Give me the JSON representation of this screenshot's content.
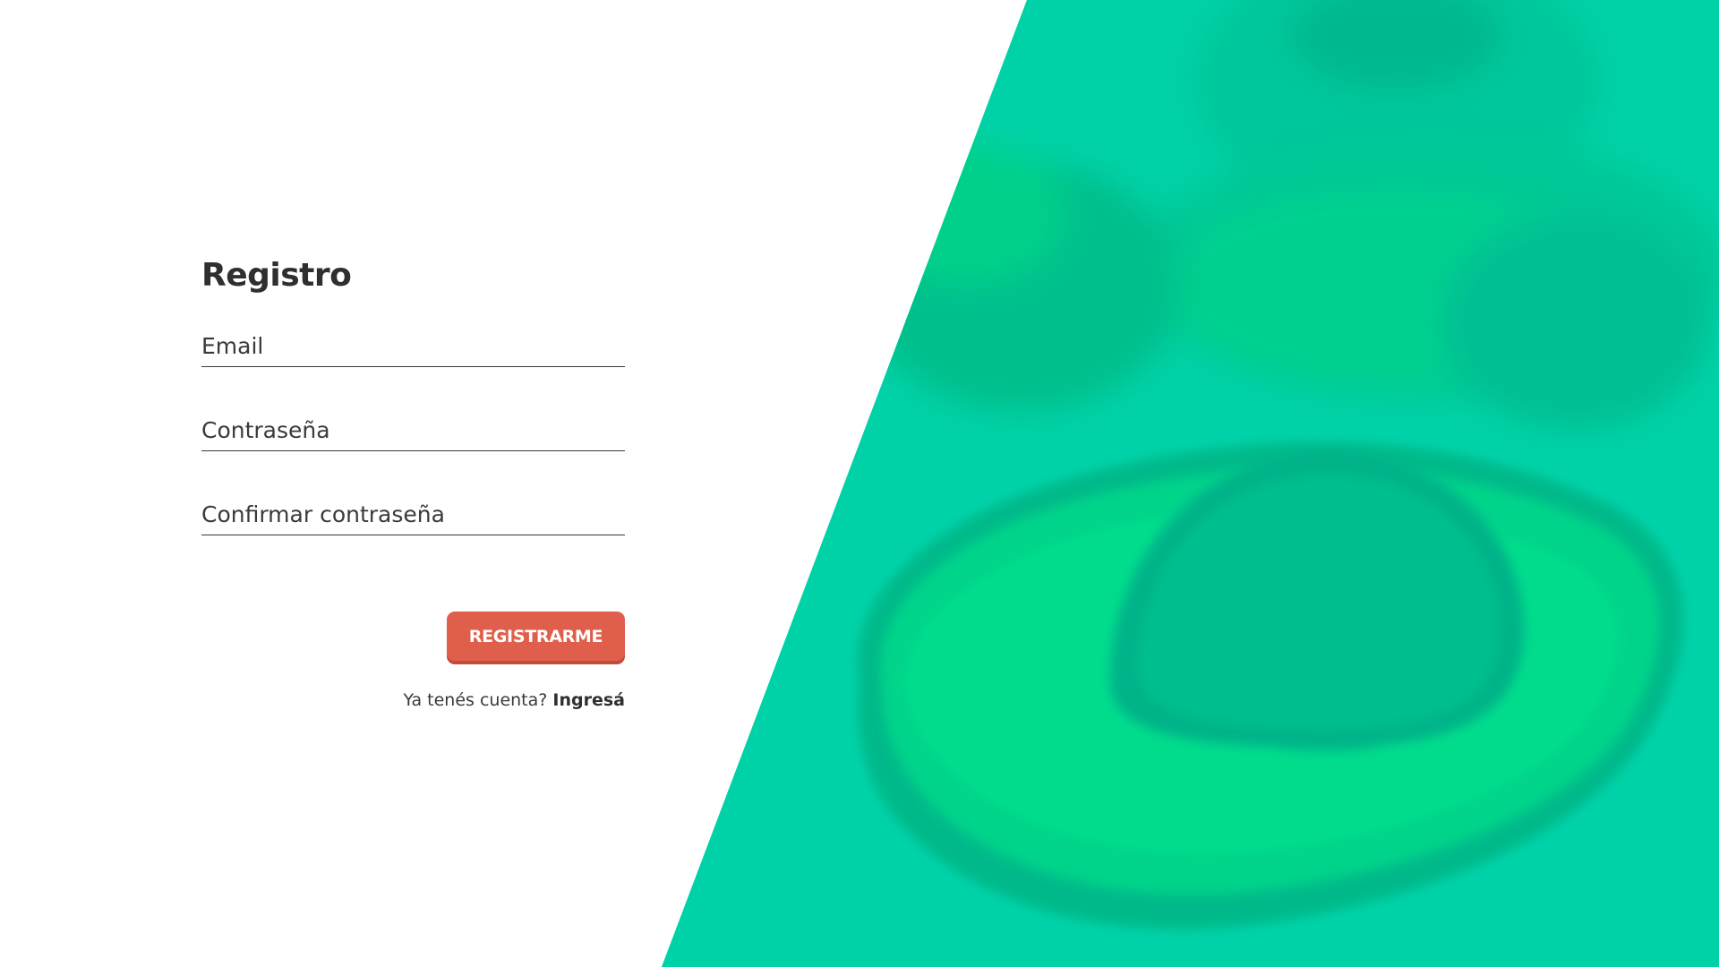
{
  "form": {
    "title": "Registro",
    "email_placeholder": "Email",
    "password_placeholder": "Contraseña",
    "confirm_placeholder": "Confirmar contraseña",
    "submit_label": "REGISTRARME",
    "login_prompt": "Ya tenés cuenta?",
    "login_link": "Ingresá"
  },
  "colors": {
    "accent_button": "#e05f4c",
    "panel_green": "#00d2a8",
    "text_dark": "#2f2f2f"
  },
  "hero": {
    "image_subject": "avocado-half-image"
  }
}
